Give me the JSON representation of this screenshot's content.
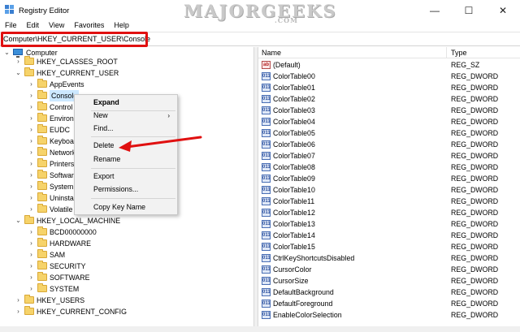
{
  "window": {
    "title": "Registry Editor",
    "watermark": "MAJORGEEKS",
    "watermark_sub": ".COM",
    "controls": {
      "minimize": "—",
      "maximize": "☐",
      "close": "✕"
    }
  },
  "menubar": [
    "File",
    "Edit",
    "View",
    "Favorites",
    "Help"
  ],
  "address": {
    "path": "Computer\\HKEY_CURRENT_USER\\Console"
  },
  "tree": {
    "root": "Computer",
    "items": [
      {
        "label": "HKEY_CLASSES_ROOT"
      },
      {
        "label": "HKEY_CURRENT_USER"
      },
      {
        "label": "AppEvents"
      },
      {
        "label": "Console"
      },
      {
        "label": "Control P"
      },
      {
        "label": "Environm"
      },
      {
        "label": "EUDC"
      },
      {
        "label": "Keyboard"
      },
      {
        "label": "Network"
      },
      {
        "label": "Printers"
      },
      {
        "label": "Software"
      },
      {
        "label": "System"
      },
      {
        "label": "Uninstall"
      },
      {
        "label": "Volatile E"
      },
      {
        "label": "HKEY_LOCAL_MACHINE"
      },
      {
        "label": "BCD00000000"
      },
      {
        "label": "HARDWARE"
      },
      {
        "label": "SAM"
      },
      {
        "label": "SECURITY"
      },
      {
        "label": "SOFTWARE"
      },
      {
        "label": "SYSTEM"
      },
      {
        "label": "HKEY_USERS"
      },
      {
        "label": "HKEY_CURRENT_CONFIG"
      }
    ]
  },
  "list": {
    "headers": {
      "name": "Name",
      "type": "Type"
    },
    "rows": [
      {
        "name": "(Default)",
        "type": "REG_SZ",
        "icon": "ab"
      },
      {
        "name": "ColorTable00",
        "type": "REG_DWORD",
        "icon": "011"
      },
      {
        "name": "ColorTable01",
        "type": "REG_DWORD",
        "icon": "011"
      },
      {
        "name": "ColorTable02",
        "type": "REG_DWORD",
        "icon": "011"
      },
      {
        "name": "ColorTable03",
        "type": "REG_DWORD",
        "icon": "011"
      },
      {
        "name": "ColorTable04",
        "type": "REG_DWORD",
        "icon": "011"
      },
      {
        "name": "ColorTable05",
        "type": "REG_DWORD",
        "icon": "011"
      },
      {
        "name": "ColorTable06",
        "type": "REG_DWORD",
        "icon": "011"
      },
      {
        "name": "ColorTable07",
        "type": "REG_DWORD",
        "icon": "011"
      },
      {
        "name": "ColorTable08",
        "type": "REG_DWORD",
        "icon": "011"
      },
      {
        "name": "ColorTable09",
        "type": "REG_DWORD",
        "icon": "011"
      },
      {
        "name": "ColorTable10",
        "type": "REG_DWORD",
        "icon": "011"
      },
      {
        "name": "ColorTable11",
        "type": "REG_DWORD",
        "icon": "011"
      },
      {
        "name": "ColorTable12",
        "type": "REG_DWORD",
        "icon": "011"
      },
      {
        "name": "ColorTable13",
        "type": "REG_DWORD",
        "icon": "011"
      },
      {
        "name": "ColorTable14",
        "type": "REG_DWORD",
        "icon": "011"
      },
      {
        "name": "ColorTable15",
        "type": "REG_DWORD",
        "icon": "011"
      },
      {
        "name": "CtrlKeyShortcutsDisabled",
        "type": "REG_DWORD",
        "icon": "011"
      },
      {
        "name": "CursorColor",
        "type": "REG_DWORD",
        "icon": "011"
      },
      {
        "name": "CursorSize",
        "type": "REG_DWORD",
        "icon": "011"
      },
      {
        "name": "DefaultBackground",
        "type": "REG_DWORD",
        "icon": "011"
      },
      {
        "name": "DefaultForeground",
        "type": "REG_DWORD",
        "icon": "011"
      },
      {
        "name": "EnableColorSelection",
        "type": "REG_DWORD",
        "icon": "011"
      }
    ]
  },
  "context_menu": {
    "items": [
      {
        "label": "Expand",
        "bold": true
      },
      {
        "label": "New",
        "submenu": "›"
      },
      {
        "label": "Find..."
      },
      {
        "label": "Delete"
      },
      {
        "label": "Rename"
      },
      {
        "label": "Export"
      },
      {
        "label": "Permissions..."
      },
      {
        "label": "Copy Key Name"
      }
    ]
  },
  "colors": {
    "highlight": "#e01010",
    "selection": "#cce8ff",
    "menu_bg": "#f2f2f2"
  }
}
